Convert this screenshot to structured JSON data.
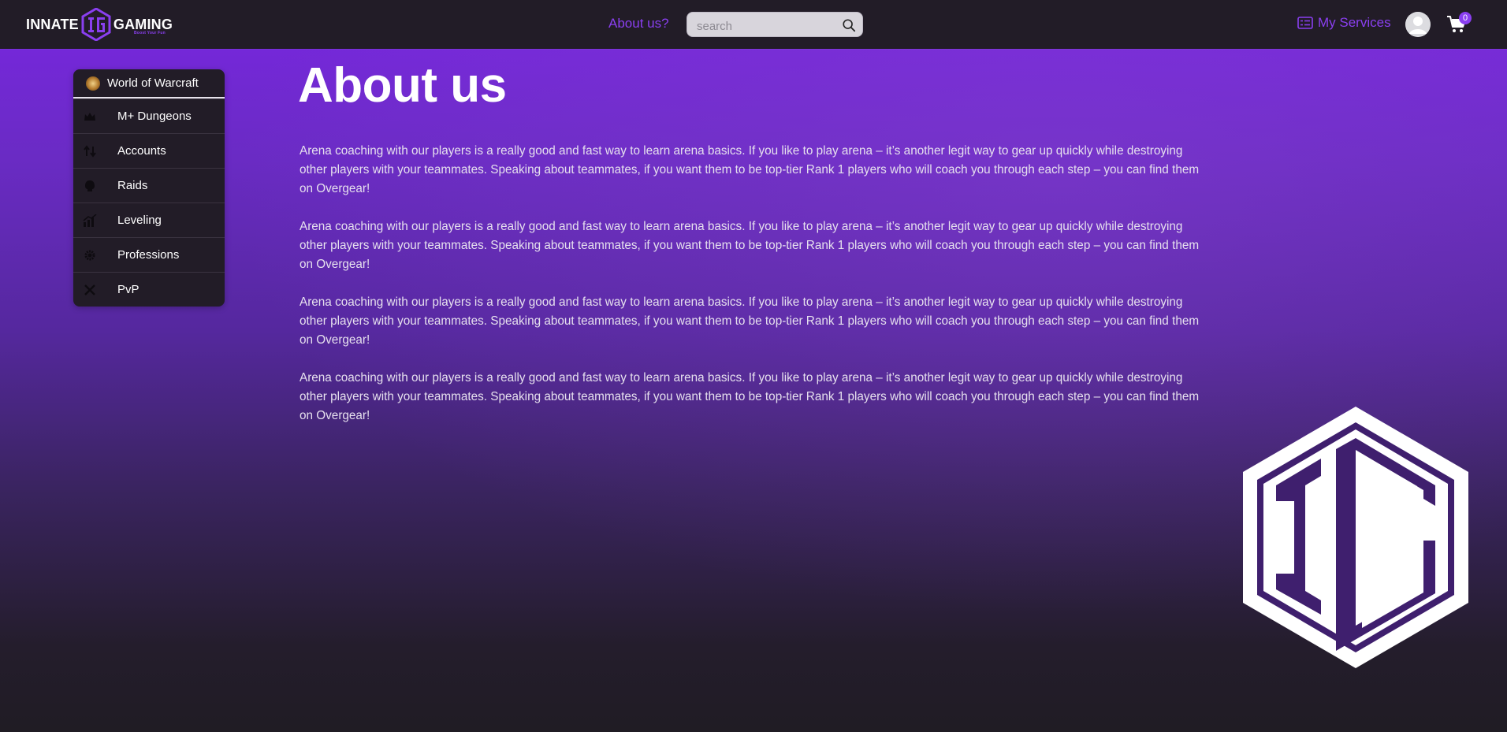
{
  "header": {
    "logo_left": "INNATE",
    "logo_right": "GAMING",
    "logo_tagline": "Boost Your Fun",
    "nav_about": "About us?",
    "search_placeholder": "search",
    "services_label": "My Services",
    "cart_count": "0"
  },
  "sidebar": {
    "game": "World of Warcraft",
    "items": [
      {
        "label": "M+ Dungeons",
        "icon": "crown-icon"
      },
      {
        "label": "Accounts",
        "icon": "swap-icon"
      },
      {
        "label": "Raids",
        "icon": "skull-icon"
      },
      {
        "label": "Leveling",
        "icon": "chart-icon"
      },
      {
        "label": "Professions",
        "icon": "gear-icon"
      },
      {
        "label": "PvP",
        "icon": "crossed-swords-icon"
      }
    ]
  },
  "main": {
    "title": "About us",
    "paragraphs": [
      "Arena coaching with our players is a really good and fast way to learn arena basics. If you like to play arena – it’s another legit way to gear up quickly while destroying other players with your teammates. Speaking about teammates, if you want them to be top-tier Rank 1 players who will coach you through each step – you can find them on Overgear!",
      "Arena coaching with our players is a really good and fast way to learn arena basics. If you like to play arena – it’s another legit way to gear up quickly while destroying other players with your teammates. Speaking about teammates, if you want them to be top-tier Rank 1 players who will coach you through each step – you can find them on Overgear!",
      "Arena coaching with our players is a really good and fast way to learn arena basics. If you like to play arena – it’s another legit way to gear up quickly while destroying other players with your teammates. Speaking about teammates, if you want them to be top-tier Rank 1 players who will coach you through each step – you can find them on Overgear!",
      "Arena coaching with our players is a really good and fast way to learn arena basics. If you like to play arena – it’s another legit way to gear up quickly while destroying other players with your teammates. Speaking about teammates, if you want them to be top-tier Rank 1 players who will coach you through each step – you can find them on Overgear!"
    ]
  },
  "colors": {
    "accent": "#8a3ff0",
    "header_bg": "#221c27",
    "hero_purple": "#7428d8"
  }
}
